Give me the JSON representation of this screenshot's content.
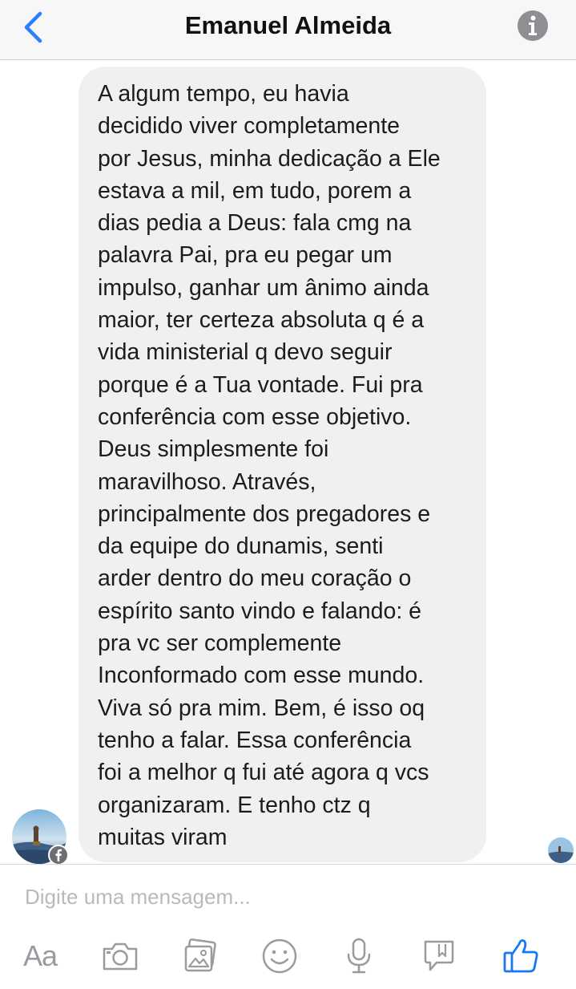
{
  "header": {
    "back_icon": "chevron-left-icon",
    "title": "Emanuel Almeida",
    "info_icon": "info-icon"
  },
  "conversation": {
    "message_text": "A algum tempo, eu havia\ndecidido viver completamente\npor Jesus, minha dedicação a Ele\nestava a mil, em tudo, porem a\ndias pedia a Deus: fala cmg na\npalavra Pai, pra eu pegar um\nimpulso, ganhar um ânimo ainda\nmaior, ter certeza absoluta q é a\nvida ministerial q devo seguir\nporque é a Tua vontade. Fui pra\nconferência com esse objetivo.\nDeus simplesmente foi\nmaravilhoso. Através,\nprincipalmente dos pregadores e\nda equipe do dunamis, senti\narder dentro do meu coração o\nespírito santo vindo e falando: é\npra vc ser complemente\nInconformado com esse mundo.\nViva só pra mim. Bem, é isso oq\ntenho a falar. Essa conferência\nfoi a melhor q fui até agora q vcs\norganizaram. E tenho ctz q\nmuitas viram",
    "sender_avatar": "avatar",
    "badge_icon": "facebook-badge-icon",
    "read_receipt": "seen-avatar"
  },
  "composer": {
    "placeholder": "Digite uma mensagem...",
    "toolbar": {
      "text_label": "Aa",
      "icons": [
        "camera-icon",
        "gallery-icon",
        "emoji-icon",
        "microphone-icon",
        "sticker-icon",
        "thumbs-up-icon"
      ]
    }
  },
  "colors": {
    "accent": "#1877f2",
    "bubble": "#f0f0f0",
    "icon_gray": "#9a9aa0"
  }
}
